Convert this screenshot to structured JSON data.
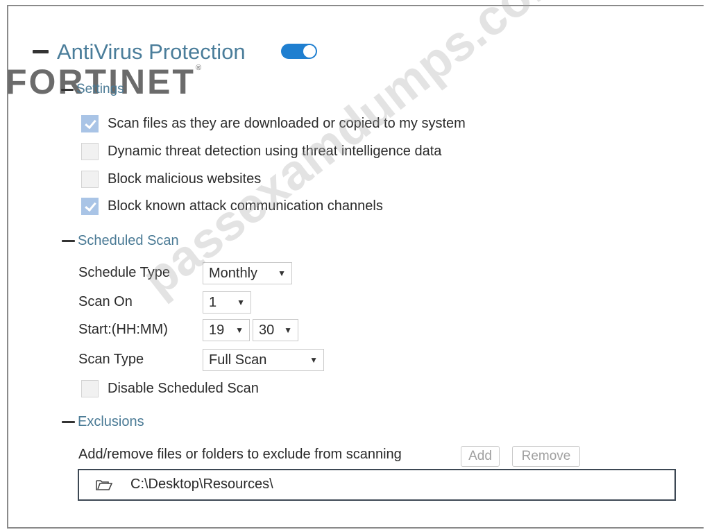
{
  "header": {
    "title": "AntiVirus Protection",
    "toggle_on": true,
    "logo_text": "FORTINET",
    "logo_mark": "®"
  },
  "settings": {
    "title": "Settings",
    "options": [
      {
        "label": "Scan files as they are downloaded or copied to my system",
        "checked": true
      },
      {
        "label": "Dynamic threat detection using threat intelligence data",
        "checked": false
      },
      {
        "label": "Block malicious websites",
        "checked": false
      },
      {
        "label": "Block known attack communication channels",
        "checked": true
      }
    ]
  },
  "scheduled_scan": {
    "title": "Scheduled Scan",
    "schedule_type_label": "Schedule Type",
    "schedule_type_value": "Monthly",
    "scan_on_label": "Scan On",
    "scan_on_value": "1",
    "start_label": "Start:(HH:MM)",
    "start_hour": "19",
    "start_minute": "30",
    "scan_type_label": "Scan Type",
    "scan_type_value": "Full Scan",
    "disable_label": "Disable Scheduled Scan",
    "disable_checked": false
  },
  "exclusions": {
    "title": "Exclusions",
    "description": "Add/remove files or folders to exclude from scanning",
    "add_label": "Add",
    "remove_label": "Remove",
    "items": [
      {
        "path": "C:\\Desktop\\Resources\\",
        "icon": "folder-icon"
      }
    ]
  },
  "watermark": "passexamdumps.com",
  "colors": {
    "accent": "#1f7fd0",
    "section_title": "#4a7a95",
    "checkbox_checked": "#a9c4e6"
  }
}
